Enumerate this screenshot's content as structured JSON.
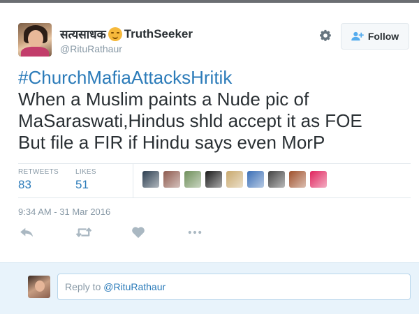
{
  "user": {
    "display_name_prefix": "सत्यसाधक",
    "display_name_suffix": "TruthSeeker",
    "handle": "@RituRathaur"
  },
  "header": {
    "follow_label": "Follow",
    "icons": {
      "settings": "gear-icon",
      "follow": "add-user-icon"
    }
  },
  "tweet": {
    "hashtag": "#ChurchMafiaAttacksHritik",
    "lines": [
      "When a Muslim paints a Nude pic of",
      "MaSaraswati,Hindus shld accept it as FOE",
      "But file a FIR if Hindu says even MorP"
    ]
  },
  "stats": {
    "retweets_label": "RETWEETS",
    "retweets_value": "83",
    "likes_label": "LIKES",
    "likes_value": "51",
    "liker_colors": [
      "#2c3e50",
      "#8e5a4e",
      "#6f8f5a",
      "#1a1a1a",
      "#c9a96e",
      "#3b6fb6",
      "#444444",
      "#a0522d",
      "#e0245e"
    ]
  },
  "timestamp": "9:34 AM - 31 Mar 2016",
  "actions": {
    "icons": [
      "reply-icon",
      "retweet-icon",
      "like-icon",
      "more-icon"
    ]
  },
  "reply": {
    "prefix": "Reply to ",
    "mention": "@RituRathaur"
  }
}
